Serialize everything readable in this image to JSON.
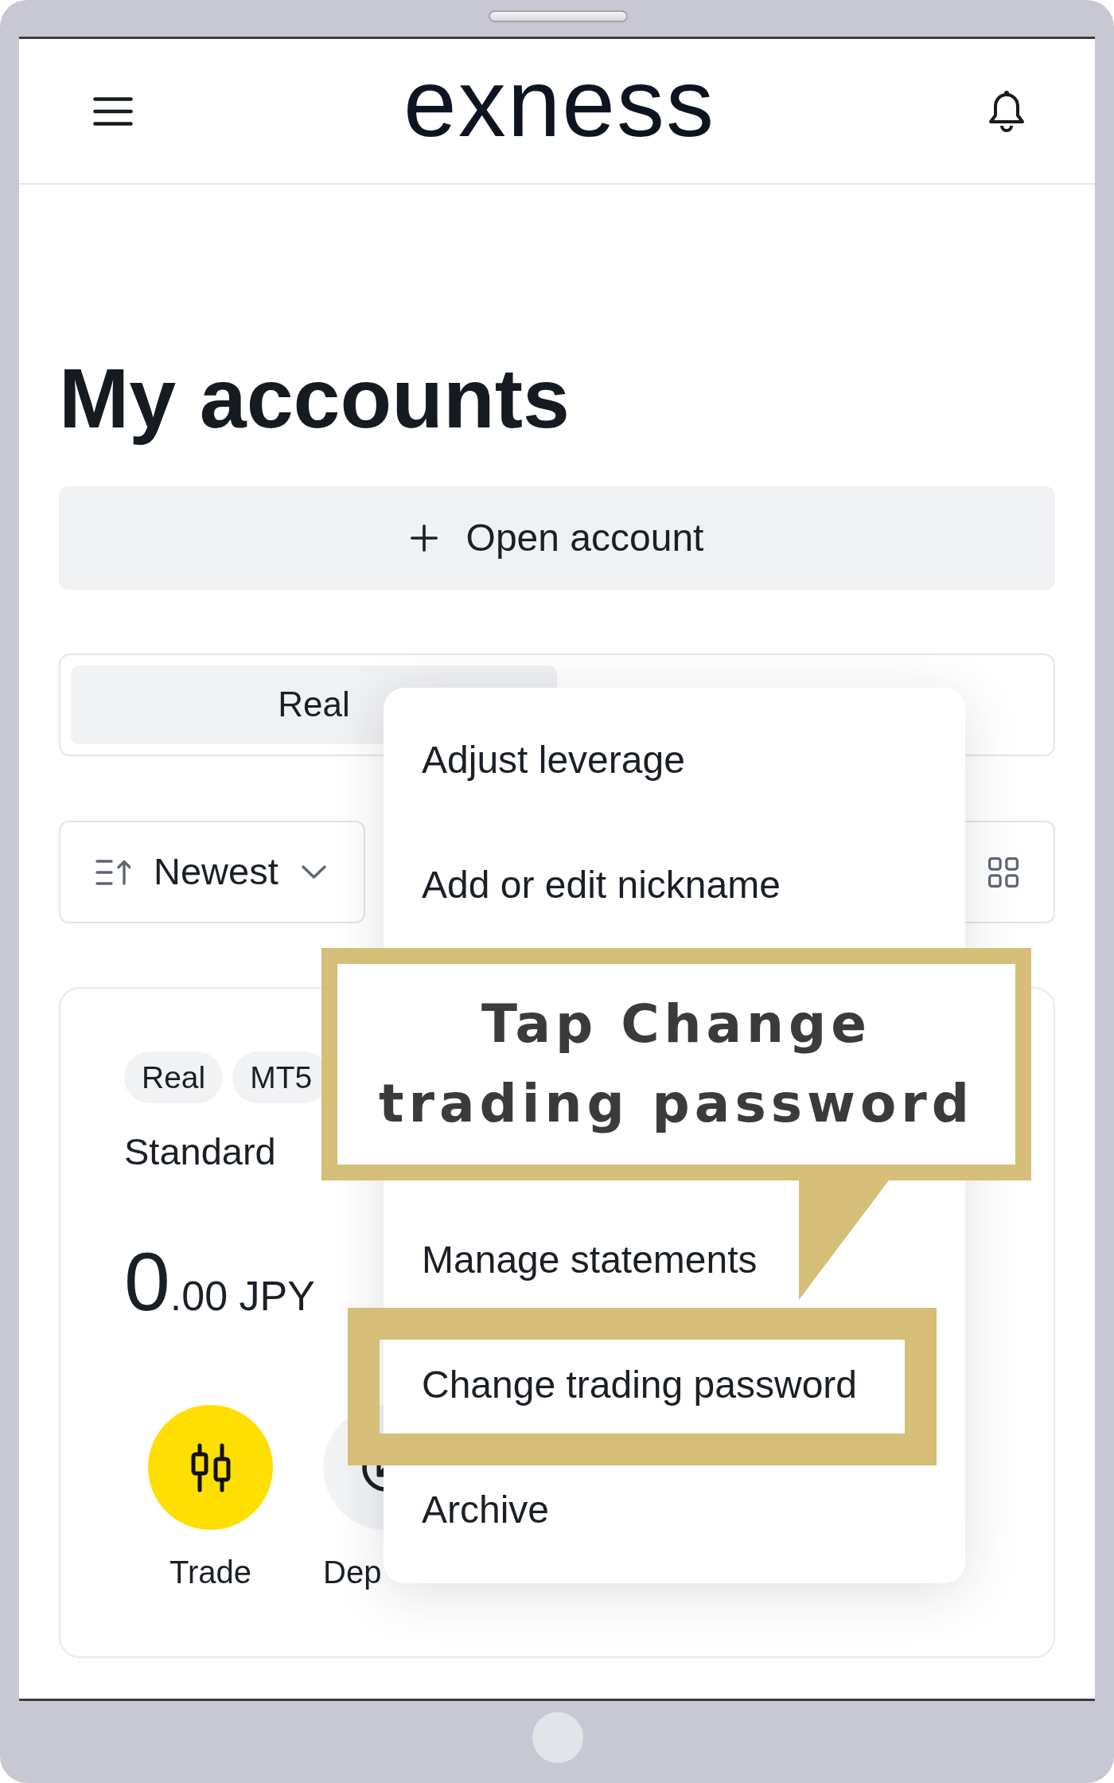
{
  "header": {
    "logo": "exness"
  },
  "title": "My accounts",
  "open_account": {
    "label": "Open account"
  },
  "account_tabs": [
    {
      "label": "Real",
      "selected": true
    }
  ],
  "sort": {
    "label": "Newest"
  },
  "account_card": {
    "tags": [
      "Real",
      "MT5"
    ],
    "type": "Standard",
    "balance": {
      "whole": "0",
      "fraction": ".00 JPY"
    },
    "actions": [
      {
        "kind": "trade",
        "label": "Trade"
      },
      {
        "kind": "deposit",
        "label": "Dep"
      }
    ]
  },
  "menu": {
    "items": [
      {
        "label": "Adjust leverage",
        "highlighted": false
      },
      {
        "label": "Add or edit nickname",
        "highlighted": false
      },
      {
        "label": "Manage statements",
        "highlighted": false
      },
      {
        "label": "Change trading password",
        "highlighted": true
      },
      {
        "label": "Archive",
        "highlighted": false
      }
    ]
  },
  "callout": {
    "text": "Tap Change trading password"
  }
}
